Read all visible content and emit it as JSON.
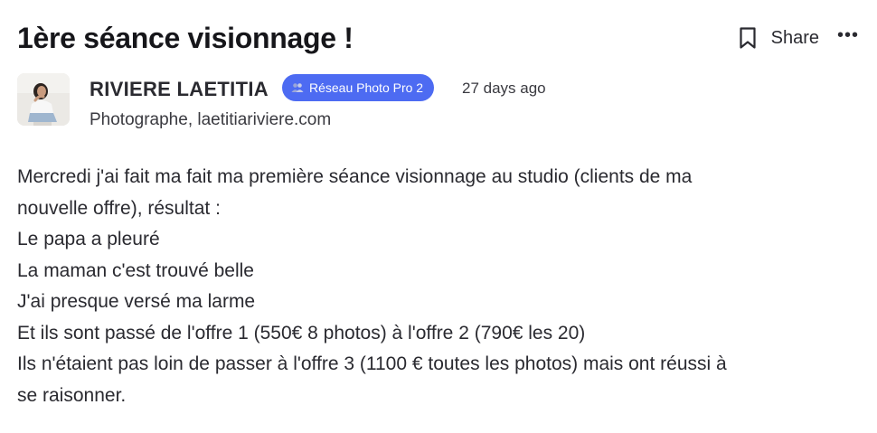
{
  "post": {
    "title": "1ère séance visionnage !",
    "actions": {
      "bookmark_icon": "bookmark-icon",
      "share_label": "Share",
      "more_icon": "ellipsis-icon",
      "more_glyph": "•••"
    },
    "author": {
      "name": "RIVIERE LAETITIA",
      "badge_label": "Réseau Photo Pro 2",
      "badge_icon": "group-icon",
      "timestamp": "27 days ago",
      "subtitle": "Photographe, laetitiariviere.com"
    },
    "body_lines": [
      "Mercredi j'ai fait ma fait ma première séance visionnage au studio (clients de ma",
      "nouvelle offre), résultat :",
      "Le papa a pleuré",
      "La maman c'est trouvé belle",
      "J'ai presque versé ma larme",
      "Et ils sont passé de l'offre 1 (550€ 8 photos) à l'offre 2 (790€ les 20)",
      "Ils n'étaient pas loin de passer à l'offre 3 (1100 € toutes les photos) mais ont réussi à",
      "se raisonner."
    ]
  },
  "colors": {
    "badge_background": "#4d6bf2",
    "text_primary": "#1f1f24",
    "text_secondary": "#3a3a40"
  }
}
